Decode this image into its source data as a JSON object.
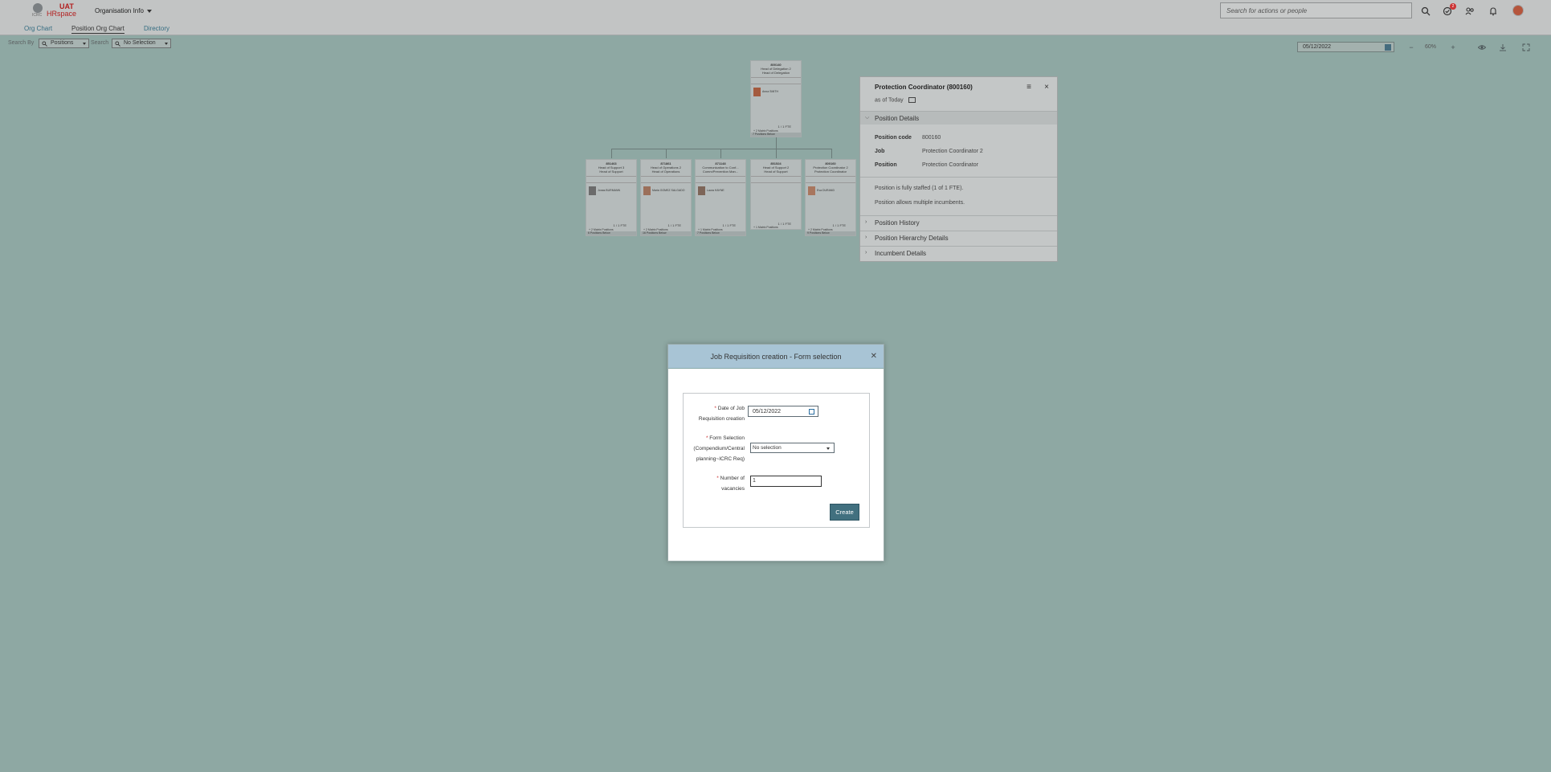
{
  "header": {
    "logo_small": "ICRC",
    "logo_env": "UAT",
    "logo_name": "HRspace",
    "module_menu": "Organisation Info",
    "search_placeholder": "Search for actions or people",
    "notification_count": "2"
  },
  "tabs": [
    {
      "label": "Org Chart",
      "active": false
    },
    {
      "label": "Position Org Chart",
      "active": true
    },
    {
      "label": "Directory",
      "active": false
    }
  ],
  "toolbar": {
    "search_by_label": "Search By",
    "search_by_value": "Positions",
    "search_label": "Search",
    "search_value": "No Selection",
    "date": "05/12/2022",
    "zoom": "60%"
  },
  "org_chart": {
    "root": {
      "code": "800140",
      "title_line1": "Head of Delegation 2",
      "title_line2": "Head of Delegation",
      "incumbent": "Anna SMITH",
      "fte": "1 / 1 FTE",
      "siblings": "+ 2 Matrix Positions",
      "below": "7 Positions Below"
    },
    "children": [
      {
        "code": "851463",
        "t1": "Head of Support 3",
        "t2": "Head of Support",
        "incumbent": "Jonas BURMANN",
        "fte": "1 / 1 FTE",
        "sib": "+ 2 Matrix Positions",
        "below": "6 Positions Below"
      },
      {
        "code": "871861",
        "t1": "Head of Operations 2",
        "t2": "Head of Operations",
        "incumbent": "Maria GOMEZ SALGADO",
        "fte": "1 / 1 FTE",
        "sib": "+ 2 Matrix Positions",
        "below": "16 Positions Below"
      },
      {
        "code": "871148",
        "t1": "Communication to Conf...",
        "t2": "Comm/Prevention Man...",
        "incumbent": "Laura HAYNE",
        "fte": "1 / 1 FTE",
        "sib": "+ 1 Matrix Positions",
        "below": "7 Positions Below"
      },
      {
        "code": "851524",
        "t1": "Head of Support 2",
        "t2": "Head of Support",
        "incumbent": "",
        "fte": "1 / 1 FTE",
        "sib": "+ 1 Matrix Positions",
        "below": ""
      },
      {
        "code": "800160",
        "t1": "Protection Coordinator 2",
        "t2": "Protection Coordinator",
        "incumbent": "Eva DURAND",
        "fte": "1 / 1 FTE",
        "sib": "+ 2 Matrix Positions",
        "below": "9 Positions Below"
      }
    ]
  },
  "panel": {
    "title": "Protection Coordinator (800160)",
    "as_of": "as of Today",
    "section_details": "Position Details",
    "position_code_label": "Position code",
    "position_code": "800160",
    "job_label": "Job",
    "job": "Protection Coordinator 2",
    "position_label": "Position",
    "position": "Protection Coordinator",
    "staffed_text": "Position is fully staffed (1 of 1 FTE).",
    "multiple_text": "Position allows multiple incumbents.",
    "section_history": "Position History",
    "section_hierarchy": "Position Hierarchy Details",
    "section_incumbent": "Incumbent Details"
  },
  "modal": {
    "title": "Job Requisition creation - Form selection",
    "date_label_1": "Date of Job",
    "date_label_2": "Requisition creation",
    "date_value": "05/12/2022",
    "form_label_1": "Form Selection",
    "form_label_2": "(Compendium/Central",
    "form_label_3": "planning~ICRC Req)",
    "form_value": "No selection",
    "vacancies_label_1": "Number of",
    "vacancies_label_2": "vacancies",
    "vacancies_value": "1",
    "create_label": "Create"
  }
}
